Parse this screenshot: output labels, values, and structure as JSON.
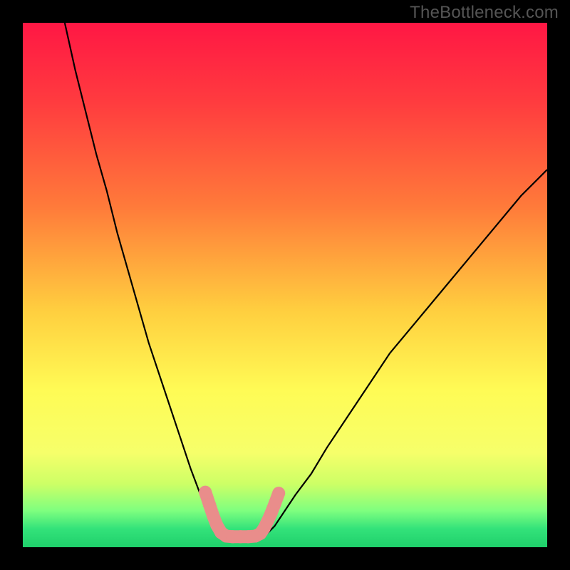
{
  "watermark": "TheBottleneck.com",
  "chart_data": {
    "type": "line",
    "title": "",
    "xlabel": "",
    "ylabel": "",
    "xlim": [
      0,
      100
    ],
    "ylim": [
      0,
      100
    ],
    "background_gradient_stops": [
      {
        "offset": 0,
        "color": "#ff1744"
      },
      {
        "offset": 0.15,
        "color": "#ff3b3f"
      },
      {
        "offset": 0.35,
        "color": "#ff7a3a"
      },
      {
        "offset": 0.55,
        "color": "#ffcf3f"
      },
      {
        "offset": 0.7,
        "color": "#fffb55"
      },
      {
        "offset": 0.82,
        "color": "#f6ff6a"
      },
      {
        "offset": 0.88,
        "color": "#ccff66"
      },
      {
        "offset": 0.93,
        "color": "#7fff7f"
      },
      {
        "offset": 0.965,
        "color": "#33e27a"
      },
      {
        "offset": 1.0,
        "color": "#1fd06b"
      }
    ],
    "series": [
      {
        "name": "left-curve",
        "x": [
          8,
          10,
          12,
          14,
          16,
          18,
          20,
          22,
          24,
          26,
          28,
          30,
          32,
          33.5,
          35,
          36.5,
          38
        ],
        "y": [
          100,
          91,
          83,
          75,
          68,
          60,
          53,
          46,
          39,
          33,
          27,
          21,
          15,
          11,
          7,
          4,
          2
        ]
      },
      {
        "name": "right-curve",
        "x": [
          46,
          48,
          50,
          52,
          55,
          58,
          62,
          66,
          70,
          75,
          80,
          85,
          90,
          95,
          100
        ],
        "y": [
          2,
          4,
          7,
          10,
          14,
          19,
          25,
          31,
          37,
          43,
          49,
          55,
          61,
          67,
          72
        ]
      },
      {
        "name": "valley-pink-band",
        "marker": "segment",
        "color": "#e98d8b",
        "points_xy": [
          [
            34.8,
            10.5
          ],
          [
            35.6,
            8.1
          ],
          [
            36.3,
            6.0
          ],
          [
            37.0,
            4.2
          ],
          [
            37.8,
            2.8
          ],
          [
            38.8,
            2.1
          ],
          [
            40.0,
            2.0
          ],
          [
            41.5,
            2.0
          ],
          [
            43.0,
            2.0
          ],
          [
            44.3,
            2.1
          ],
          [
            45.3,
            2.6
          ],
          [
            46.0,
            3.6
          ],
          [
            46.7,
            5.0
          ],
          [
            47.4,
            6.6
          ],
          [
            48.1,
            8.4
          ],
          [
            48.8,
            10.3
          ]
        ]
      }
    ]
  }
}
